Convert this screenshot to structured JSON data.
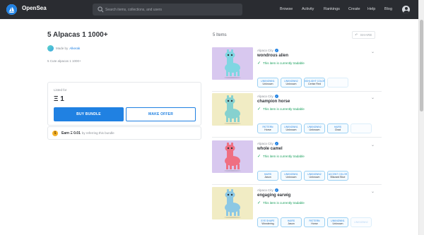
{
  "header": {
    "brand": "OpenSea",
    "search_placeholder": "Search items, collections, and users",
    "nav": [
      "Browse",
      "Activity",
      "Rankings",
      "Create",
      "Help",
      "Blog"
    ]
  },
  "bundle": {
    "title": "5 Alpacas 1 1000+",
    "made_by_label": "Made by",
    "made_by_user": "Alkerak",
    "description": "5 Cute alpacas 1 1000+",
    "listed_for_label": "Listed for",
    "price": "Ξ 1",
    "buy_button": "BUY BUNDLE",
    "offer_button": "MAKE OFFER",
    "earn_bold": "Earn Ξ 0.01",
    "earn_rest": "by referring this bundle"
  },
  "items_header": {
    "count": "5 Items",
    "share": "SHARE"
  },
  "cards": [
    {
      "collection": "Alpaca City",
      "name": "wondrous alien",
      "status": "This item is currently tradable",
      "bg": "#d8c8ef",
      "body_color": "#7fd6e2",
      "traits": [
        {
          "k": "UNKNOWN1",
          "v": "Unknown"
        },
        {
          "k": "UNKNOWN2",
          "v": "Unknown"
        },
        {
          "k": "HIGHLIGHT COLOR",
          "v": "Cerise Red"
        },
        {
          "k": "",
          "v": ""
        }
      ]
    },
    {
      "collection": "Alpaca City",
      "name": "champion horse",
      "status": "This item is currently tradable",
      "bg": "#f1ecc4",
      "body_color": "#86d1cf",
      "traits": [
        {
          "k": "PATTERN",
          "v": "Horse"
        },
        {
          "k": "UNKNOWN1",
          "v": "Unknown"
        },
        {
          "k": "UNKNOWN2",
          "v": "Unknown"
        },
        {
          "k": "HAIRS",
          "v": "Chad"
        },
        {
          "k": "",
          "v": ""
        }
      ]
    },
    {
      "collection": "Alpaca City",
      "name": "whole camel",
      "status": "This item is currently tradable",
      "bg": "#d8c8ef",
      "body_color": "#ef6f82",
      "traits": [
        {
          "k": "HAIRS",
          "v": "Jason"
        },
        {
          "k": "UNKNOWN1",
          "v": "Unknown"
        },
        {
          "k": "UNKNOWN2",
          "v": "Unknown"
        },
        {
          "k": "ACCENT COLOR",
          "v": "Blizzard Blue"
        }
      ]
    },
    {
      "collection": "Alpaca City",
      "name": "engaging earwig",
      "status": "This item is currently tradable",
      "bg": "#f1ecc4",
      "body_color": "#8cc8e4",
      "traits": [
        {
          "k": "EYE SHAPE",
          "v": "Wondering"
        },
        {
          "k": "HAIRS",
          "v": "Jason"
        },
        {
          "k": "PATTERN",
          "v": "Horse"
        },
        {
          "k": "UNKNOWN1",
          "v": "Unknown"
        },
        {
          "k": "UNKNOWN2",
          "v": ""
        }
      ]
    }
  ],
  "colors": {
    "accent": "#2081e2",
    "header_bg": "#2a2c31",
    "tradable": "#1aa05d"
  }
}
